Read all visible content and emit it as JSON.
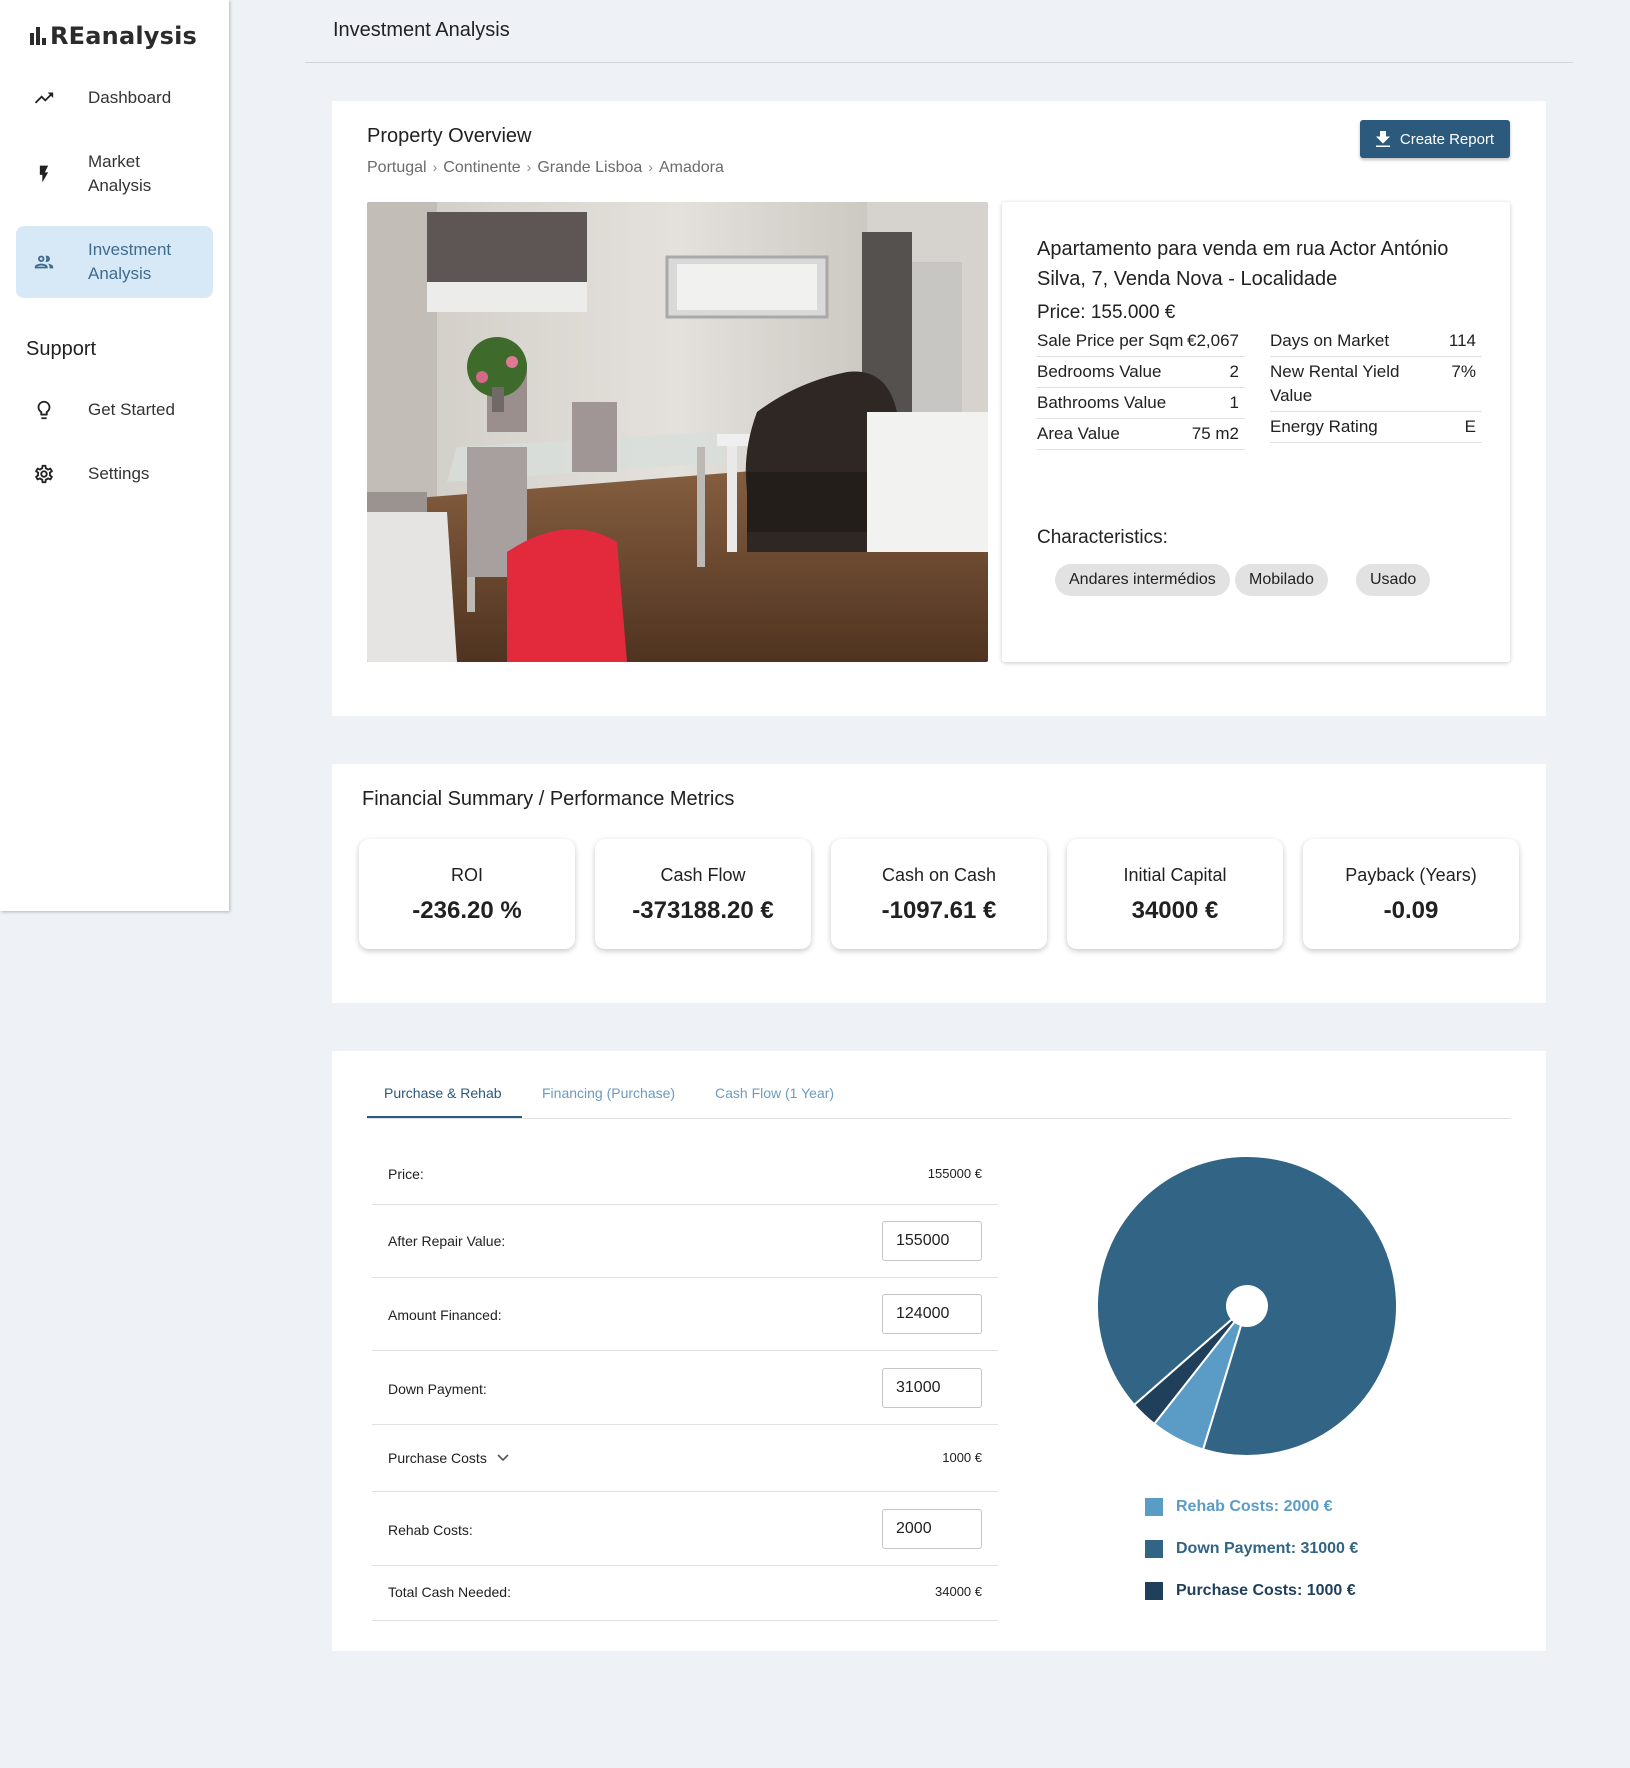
{
  "app": {
    "logo_text": "REanalysis"
  },
  "sidebar": {
    "items": [
      {
        "label": "Dashboard",
        "icon": "trending-up-icon"
      },
      {
        "label": "Market\nAnalysis",
        "icon": "bolt-icon"
      },
      {
        "label": "Investment\nAnalysis",
        "icon": "people-icon",
        "active": true
      }
    ],
    "support_heading": "Support",
    "support_items": [
      {
        "label": "Get Started",
        "icon": "lightbulb-icon"
      },
      {
        "label": "Settings",
        "icon": "gear-icon"
      }
    ]
  },
  "header": {
    "title": "Investment Analysis"
  },
  "overview": {
    "title": "Property Overview",
    "breadcrumb": [
      "Portugal",
      "Continente",
      "Grande Lisboa",
      "Amadora"
    ],
    "report_button": "Create Report",
    "listing_title": "Apartamento para venda em rua Actor António Silva, 7, Venda Nova - Localidade",
    "price": "Price: 155.000 €",
    "details_left": [
      {
        "key": "Sale Price per Sqm",
        "value": "€2,067"
      },
      {
        "key": "Bedrooms Value",
        "value": "2"
      },
      {
        "key": "Bathrooms Value",
        "value": "1"
      },
      {
        "key": "Area Value",
        "value": "75 m2"
      }
    ],
    "details_right": [
      {
        "key": "Days on Market",
        "value": "114"
      },
      {
        "key": "New Rental Yield Value",
        "value": "7%"
      },
      {
        "key": "Energy Rating",
        "value": "E"
      }
    ],
    "characteristics_label": "Characteristics:",
    "characteristics": [
      "Andares intermédios",
      "Mobilado",
      "Usado"
    ]
  },
  "financial": {
    "title": "Financial Summary / Performance Metrics",
    "metrics": [
      {
        "label": "ROI",
        "value": "-236.20 %"
      },
      {
        "label": "Cash Flow",
        "value": "-373188.20 €"
      },
      {
        "label": "Cash on Cash",
        "value": "-1097.61 €"
      },
      {
        "label": "Initial Capital",
        "value": "34000 €"
      },
      {
        "label": "Payback (Years)",
        "value": "-0.09"
      }
    ]
  },
  "calculator": {
    "tabs": [
      "Purchase & Rehab",
      "Financing (Purchase)",
      "Cash Flow (1 Year)"
    ],
    "active_tab": 0,
    "rows": {
      "price_label": "Price:",
      "price_value": "155000 €",
      "arv_label": "After Repair Value:",
      "arv_value": "155000",
      "financed_label": "Amount Financed:",
      "financed_value": "124000",
      "down_label": "Down Payment:",
      "down_value": "31000",
      "purchase_costs_label": "Purchase Costs",
      "purchase_costs_value": "1000 €",
      "rehab_label": "Rehab Costs:",
      "rehab_value": "2000",
      "total_label": "Total Cash Needed:",
      "total_value": "34000 €"
    }
  },
  "chart_data": {
    "type": "pie",
    "categories": [
      "Rehab Costs",
      "Down Payment",
      "Purchase Costs"
    ],
    "values": [
      2000,
      31000,
      1000
    ],
    "colors": [
      "#5b9cc6",
      "#316485",
      "#1f3f5a"
    ],
    "legend": [
      "Rehab Costs: 2000 €",
      "Down Payment: 31000 €",
      "Purchase Costs: 1000 €"
    ],
    "legend_position": "bottom"
  }
}
